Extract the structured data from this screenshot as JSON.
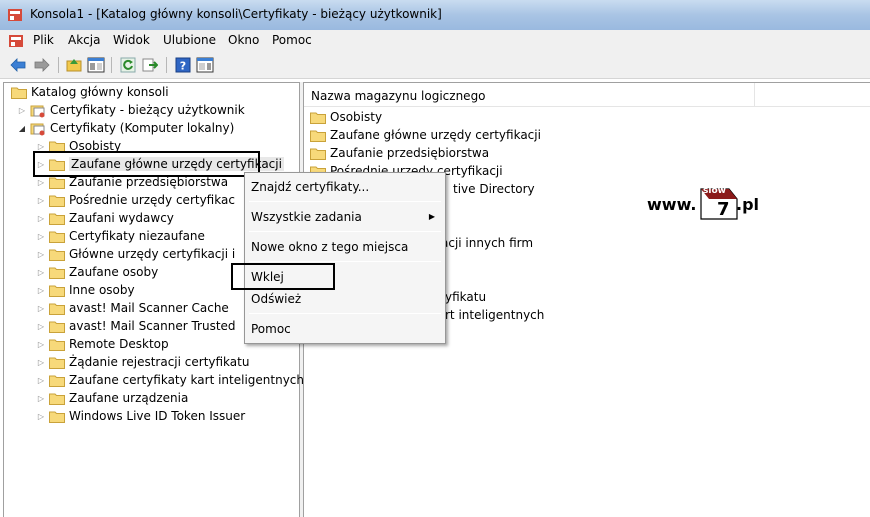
{
  "window": {
    "title": "Konsola1 - [Katalog główny konsoli\\Certyfikaty - bieżący użytkownik]"
  },
  "menubar": {
    "items": [
      "Plik",
      "Akcja",
      "Widok",
      "Ulubione",
      "Okno",
      "Pomoc"
    ]
  },
  "toolbar": {
    "buttons": [
      "back-icon",
      "forward-icon",
      "up-folder-icon",
      "show-hide-tree-icon",
      "refresh-icon",
      "export-icon",
      "help-icon",
      "show-hide-action-pane-icon"
    ]
  },
  "tree": {
    "root": "Katalog główny konsoli",
    "nodes": [
      {
        "label": "Certyfikaty - bieżący użytkownik",
        "expanded": false
      },
      {
        "label": "Certyfikaty (Komputer lokalny)",
        "expanded": true
      },
      {
        "label": "Osobisty"
      },
      {
        "label": "Zaufane główne urzędy certyfikacji",
        "selected": true
      },
      {
        "label": "Zaufanie przedsiębiorstwa"
      },
      {
        "label": "Pośrednie urzędy certyfikac"
      },
      {
        "label": "Zaufani wydawcy"
      },
      {
        "label": "Certyfikaty niezaufane"
      },
      {
        "label": "Główne urzędy certyfikacji i"
      },
      {
        "label": "Zaufane osoby"
      },
      {
        "label": "Inne osoby"
      },
      {
        "label": "avast! Mail Scanner Cache"
      },
      {
        "label": "avast! Mail Scanner Trusted"
      },
      {
        "label": "Remote Desktop"
      },
      {
        "label": "Żądanie rejestracji certyfikatu"
      },
      {
        "label": "Zaufane certyfikaty kart inteligentnych"
      },
      {
        "label": "Zaufane urządzenia"
      },
      {
        "label": "Windows Live ID Token Issuer"
      }
    ]
  },
  "list": {
    "column_header": "Nazwa magazynu logicznego",
    "items": [
      "Osobisty",
      "Zaufane główne urzędy certyfikacji",
      "Zaufanie przedsiębiorstwa",
      "Pośrednie urzędy certyfikacji",
      "tive Directory",
      "",
      "",
      "acji innych firm",
      "",
      "",
      "yfikatu",
      "rt inteligentnych"
    ]
  },
  "context_menu": {
    "items": [
      "Znajdź certyfikaty...",
      "Wszystkie zadania",
      "Nowe okno z tego miejsca",
      "Wklej",
      "Odśwież",
      "Pomoc"
    ]
  },
  "watermark": {
    "prefix": "www.",
    "box_top": "slow",
    "box_digit": "7",
    "suffix": ".pl"
  },
  "colors": {
    "folder": "#f2c94c",
    "titlebar": "#a9c4e4",
    "highlight_border": "#000000"
  }
}
